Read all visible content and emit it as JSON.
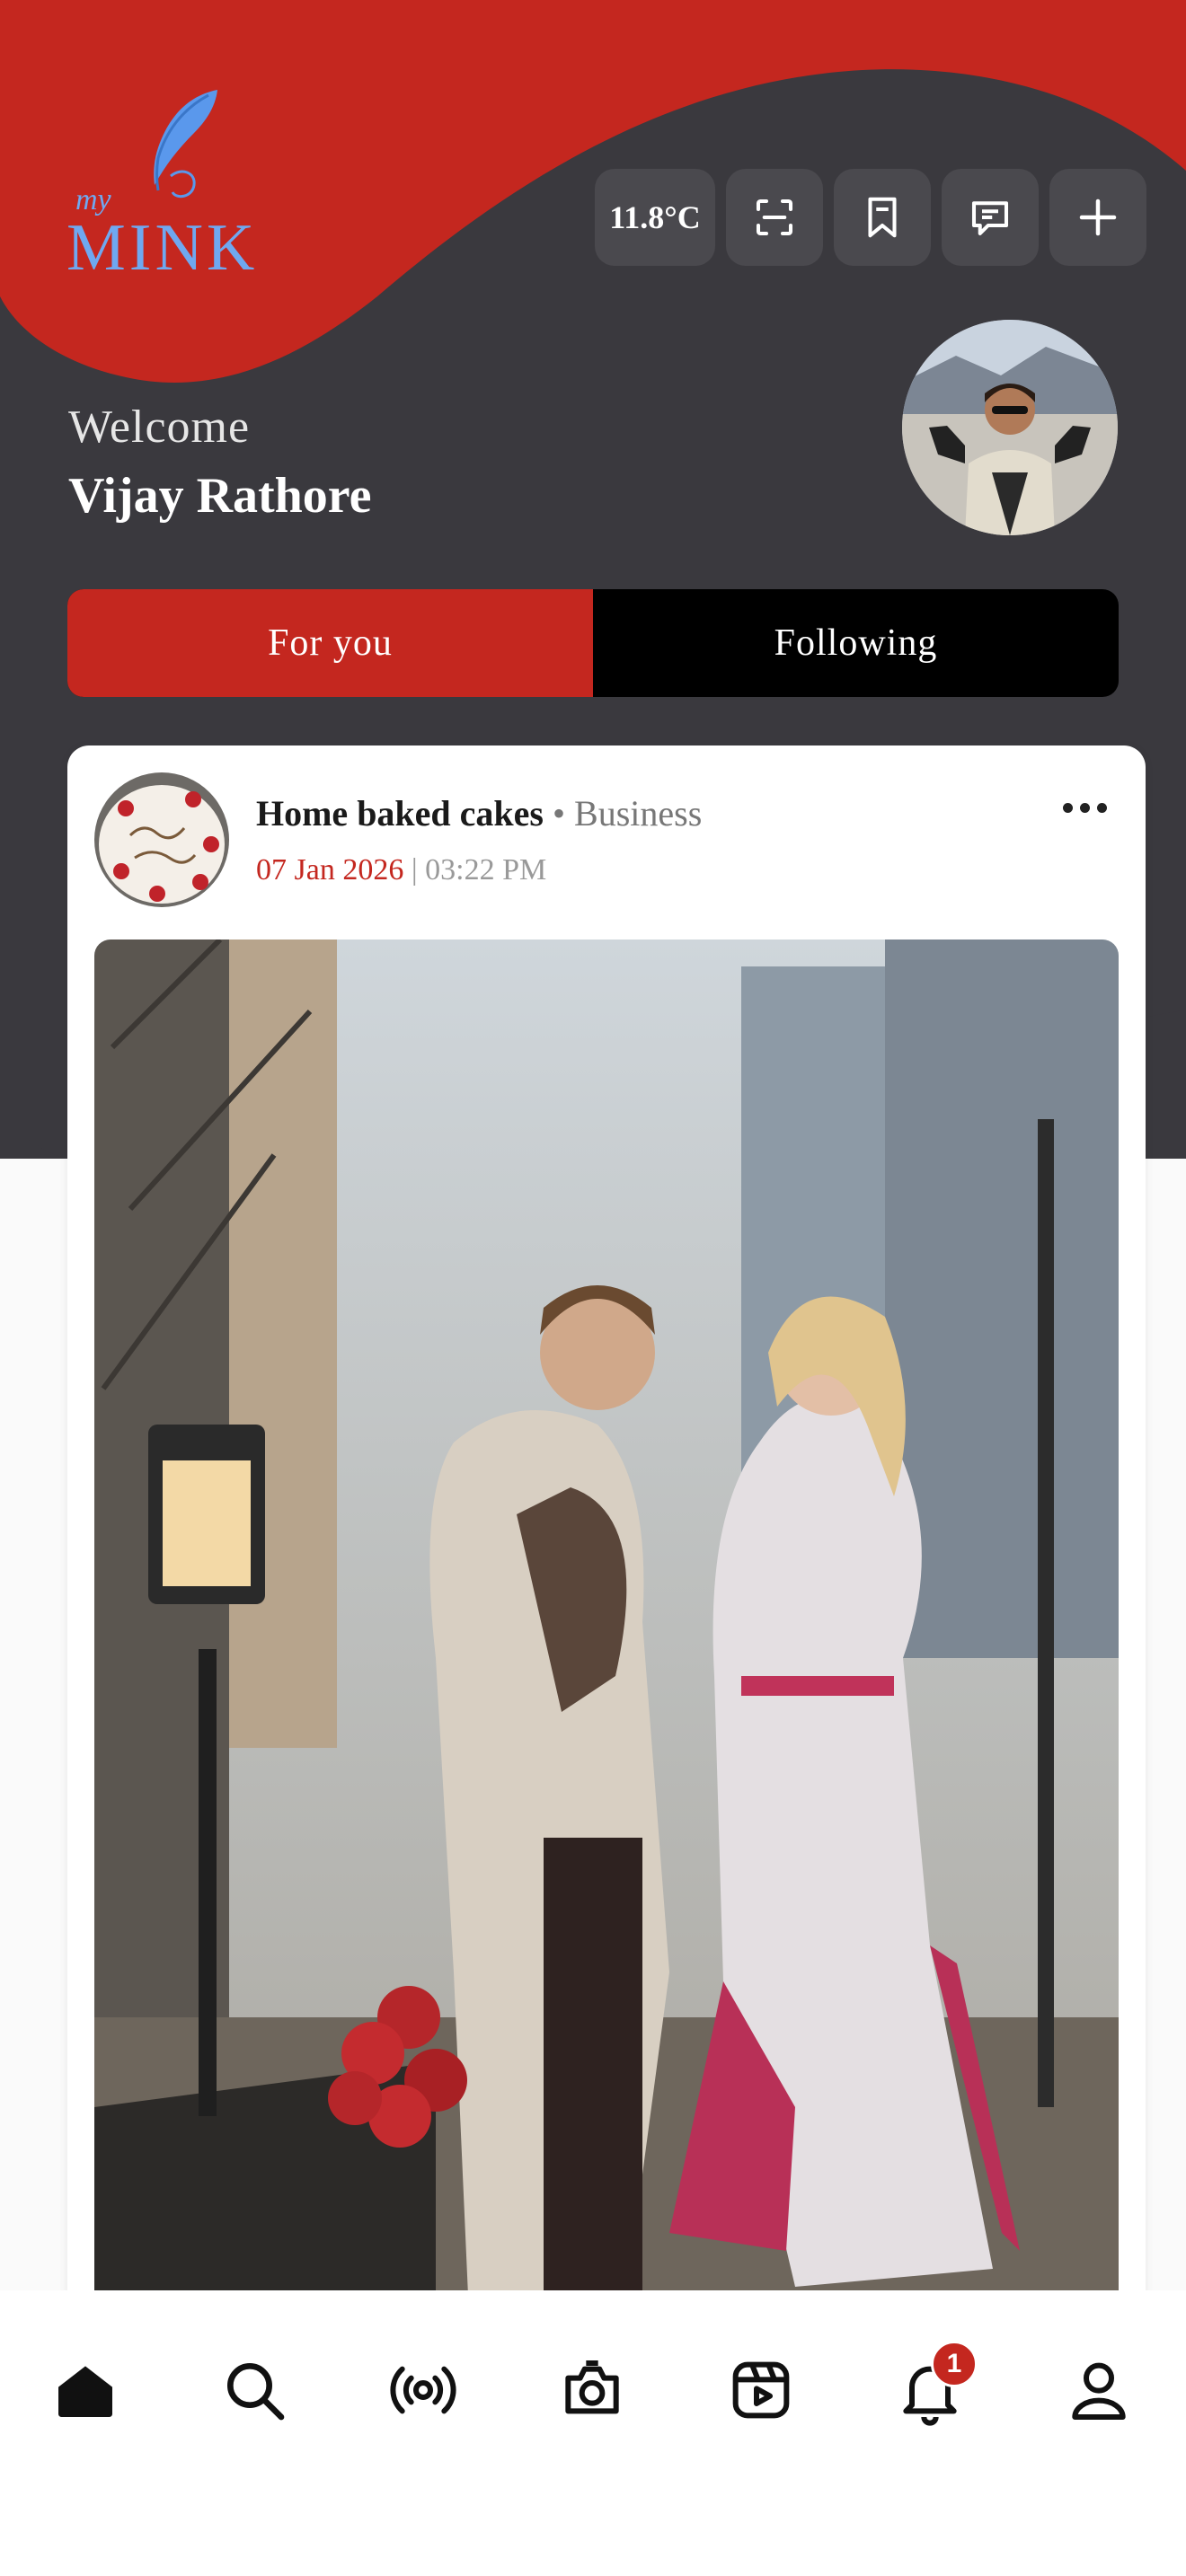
{
  "app": {
    "logo": {
      "prefix": "my",
      "name": "MINK"
    },
    "brand_color": "#c4271f",
    "dark_color": "#3a393e"
  },
  "header": {
    "weather": "11.8°C",
    "actions": [
      "scan-icon",
      "bookmark-icon",
      "message-icon",
      "plus-icon"
    ]
  },
  "greeting": {
    "welcome": "Welcome",
    "user_name": "Vijay Rathore"
  },
  "feed_tabs": [
    {
      "label": "For you",
      "active": true
    },
    {
      "label": "Following",
      "active": false
    }
  ],
  "post": {
    "author": "Home baked cakes",
    "separator": "•",
    "category": "Business",
    "date": "07 Jan 2026",
    "time": "| 03:22 PM"
  },
  "bottom_nav": {
    "items": [
      "home-icon",
      "search-icon",
      "live-icon",
      "camera-icon",
      "reels-icon",
      "bell-icon",
      "profile-icon"
    ],
    "notification_count": "1"
  }
}
